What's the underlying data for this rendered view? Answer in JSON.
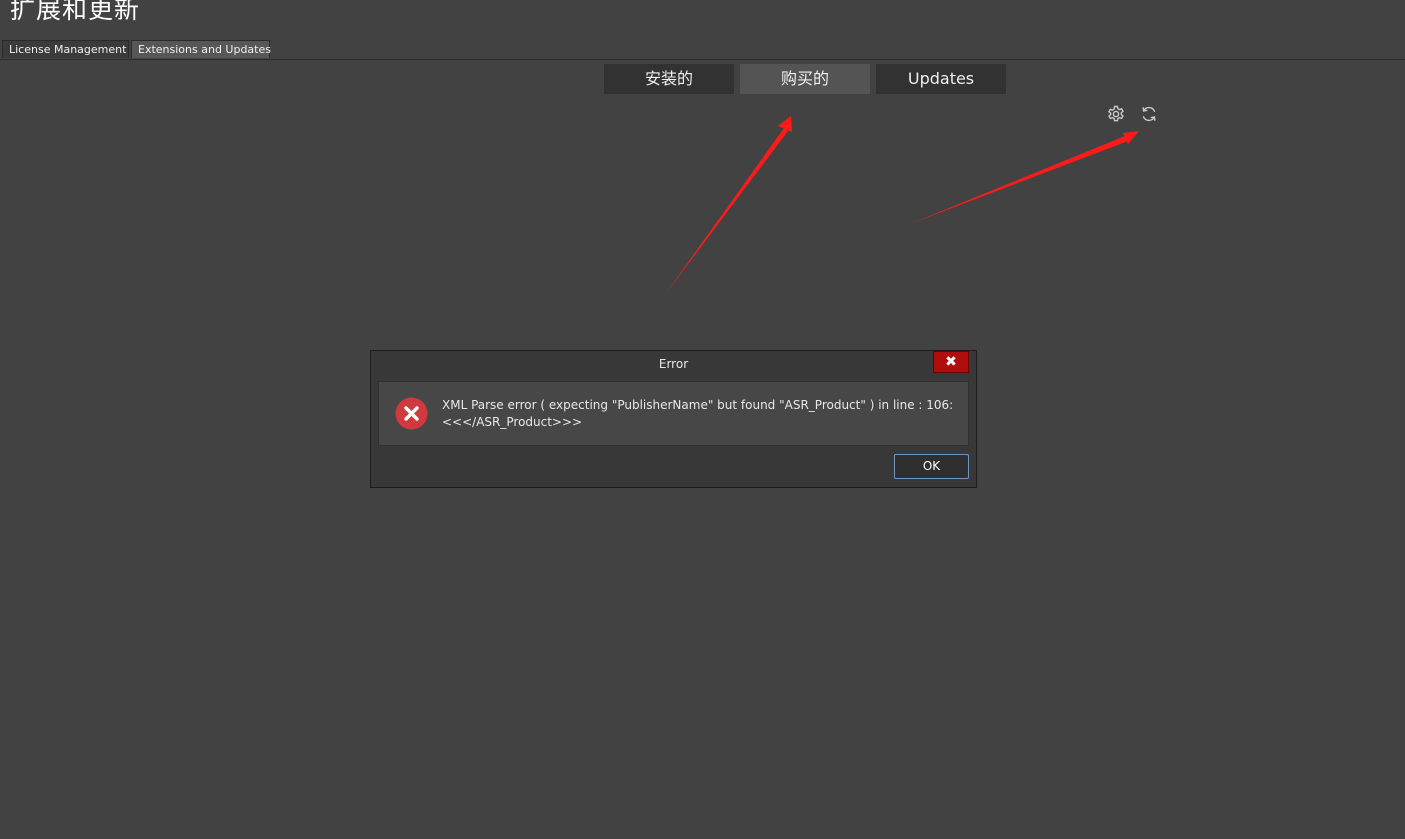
{
  "header": {
    "title": "扩展和更新"
  },
  "tabs": [
    {
      "label": "License Management",
      "active": false
    },
    {
      "label": "Extensions and Updates",
      "active": true
    }
  ],
  "segments": {
    "installed": "安装的",
    "purchased": "购买的",
    "updates": "Updates",
    "active": "purchased"
  },
  "toolbar": {
    "icons": [
      "gear-icon",
      "refresh-icon"
    ]
  },
  "dialog": {
    "title": "Error",
    "close_glyph": "✖",
    "message_line1": "XML Parse error ( expecting \"PublisherName\" but found \"ASR_Product\" ) in line : 106:",
    "message_line2": "<<</ASR_Product>>>",
    "ok_label": "OK"
  },
  "colors": {
    "background": "#424242",
    "annotation_arrow": "#ff1a1a",
    "error_icon": "#d03a3f",
    "close_button": "#b00e0e"
  }
}
